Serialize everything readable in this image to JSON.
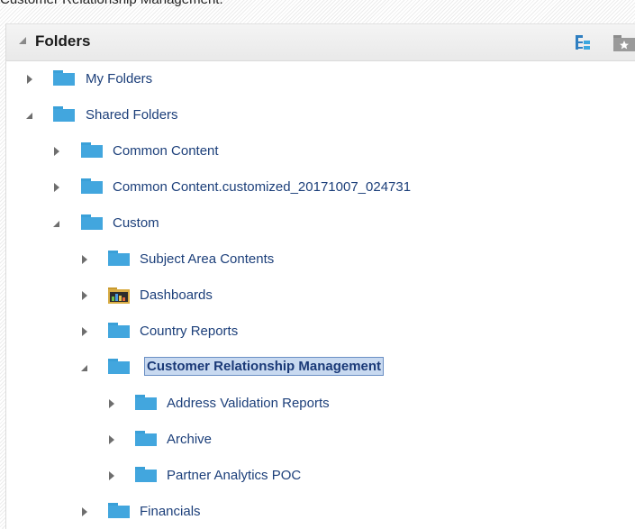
{
  "page": {
    "caption": "Customer Relationship Management."
  },
  "panel": {
    "title": "Folders",
    "header_icons": [
      "tree-view-icon",
      "favorites-folder-icon"
    ]
  },
  "colors": {
    "folder": "#42a6de",
    "label": "#1c3f7a",
    "selection_bg": "#c8d9f0",
    "selection_border": "#6b8fc4"
  },
  "tree": {
    "items": [
      {
        "label": "My Folders",
        "state": "collapsed",
        "icon": "folder-icon"
      },
      {
        "label": "Shared Folders",
        "state": "expanded",
        "icon": "folder-icon"
      },
      {
        "label": "Common Content",
        "state": "collapsed",
        "icon": "folder-icon"
      },
      {
        "label": "Common Content.customized_20171007_024731",
        "state": "collapsed",
        "icon": "folder-icon"
      },
      {
        "label": "Custom",
        "state": "expanded",
        "icon": "folder-icon"
      },
      {
        "label": "Subject Area Contents",
        "state": "collapsed",
        "icon": "folder-icon"
      },
      {
        "label": "Dashboards",
        "state": "collapsed",
        "icon": "dashboard-folder-icon"
      },
      {
        "label": "Country Reports",
        "state": "collapsed",
        "icon": "folder-icon"
      },
      {
        "label": "Customer Relationship Management",
        "state": "expanded",
        "icon": "folder-icon",
        "selected": true
      },
      {
        "label": "Address Validation Reports",
        "state": "collapsed",
        "icon": "folder-icon"
      },
      {
        "label": "Archive",
        "state": "collapsed",
        "icon": "folder-icon"
      },
      {
        "label": "Partner Analytics POC",
        "state": "collapsed",
        "icon": "folder-icon"
      },
      {
        "label": "Financials",
        "state": "collapsed",
        "icon": "folder-icon"
      }
    ]
  }
}
